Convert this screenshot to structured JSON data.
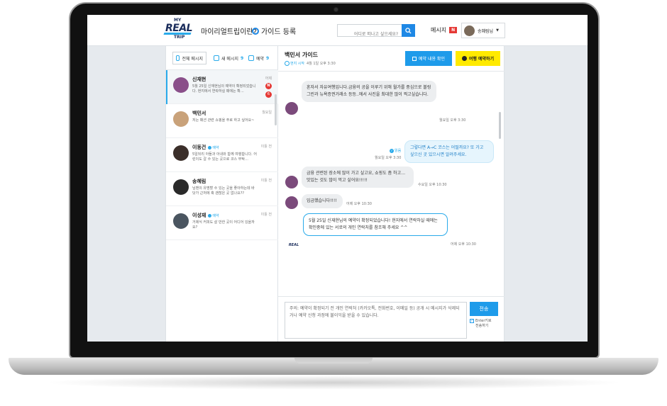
{
  "header": {
    "logo_my": "MY",
    "logo_real": "REAL",
    "logo_trip": "TRIP",
    "nav_about": "마이리얼트립이란?",
    "nav_guide": "가이드 등록",
    "search_placeholder": "어디로 떠나고 싶으세요?",
    "messages_label": "메시지",
    "messages_badge": "N",
    "username": "송혜림님"
  },
  "sidebar": {
    "tabs": [
      {
        "label": "전체 메시지",
        "count": ""
      },
      {
        "label": "새 메시지",
        "count": "9"
      },
      {
        "label": "예약",
        "count": "9"
      }
    ],
    "conversations": [
      {
        "name": "신재현",
        "tag": "",
        "time": "어제",
        "preview": "5월 25일 신재현님의 예약이 확정되었습니다. 현지에서 연락하실 때에는 확…",
        "badge": "N",
        "sub_badge": "6"
      },
      {
        "name": "백민서",
        "tag": "",
        "time": "월요일",
        "preview": "저는 패션 관련 쇼핑을 주로 하고 싶어요~",
        "badge": "",
        "sub_badge": ""
      },
      {
        "name": "이동건",
        "tag": "예약",
        "time": "이틀 전",
        "preview": "5일뒤리 아들과 아내와 함께 여행합니다. 어린이도 갈 수 있는 곳으로 코스 부탁…",
        "badge": "",
        "sub_badge": ""
      },
      {
        "name": "송혜림",
        "tag": "",
        "time": "이틀 전",
        "preview": "님맨의 유명할 수 있는 곳을 좋아하는데 바닷가 근처에 혹 괜찮은 곳 없나요??",
        "badge": "",
        "sub_badge": ""
      },
      {
        "name": "이성재",
        "tag": "예약",
        "time": "이틀 전",
        "preview": "거제식 커피도 살 만한 곳이 어디어 있을까요?",
        "badge": "",
        "sub_badge": ""
      }
    ]
  },
  "chat": {
    "title": "백민서 가이드",
    "status": "현지 시작",
    "date": "4월 1일 오후 3:30",
    "confirm_button": "예약 내용 확인",
    "pay_button": "여행 예약하기",
    "messages": [
      {
        "from": "guide",
        "text": "혼자서 자유여행입니다.금융의 공을 이루기 위해 월가를 중심으로 볼링그린과 뉴욕증권거래소 등등..에서 사진을 최대한 많이 찍고싶습니다.",
        "time": "월요일 오후 3:30"
      },
      {
        "from": "me",
        "text": "그렇다면 A→C 코스는 어떨까요? 또 가고 싶으신 곳 있으시면 알려주세요.",
        "time": "월요일 오후 3:30",
        "read": "읽음"
      },
      {
        "from": "guide",
        "text": "금융 관련된 장소에 많이 가고 싶고요, 쇼핑도 좀 하고… 맛있는 것도 많이 먹고 싶어요!!!!!",
        "time": "수요일 오후 10:30"
      },
      {
        "from": "guide",
        "text": "입금했습니다!!!!",
        "time": "어제 오후 10:30"
      },
      {
        "from": "system",
        "text": "5월 25일 신재현님의 예약이 확정되었습니다! 현지에서 연락하실 때에는 확인중에 있는 서로의 개인 연락처를 참조해 주세요 ^^",
        "time": "어제 오후 10:30"
      }
    ],
    "composer_text": "주의: 예약이 확정되기 전 개인 연락처 (카카오톡, 전화번호, 이메일 등) 공개 시 메시지가 삭제되거나 예약 신청 과정에 불이익을 받을 수 있습니다.",
    "send_label": "전송",
    "enter_to_send": "Enter키로 전송하기"
  },
  "colors": {
    "accent": "#1e9bea",
    "pay": "#ffea00",
    "badge": "#e53935"
  }
}
